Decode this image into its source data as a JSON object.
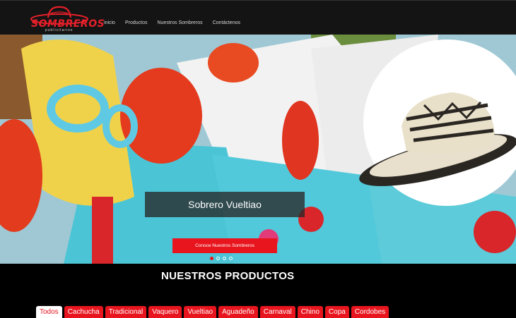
{
  "brand": {
    "logo_text": "SOMBREROS",
    "logo_subtext": "publicitarios"
  },
  "nav": {
    "items": [
      "inicio",
      "Productos",
      "Nuestros Sombreros",
      "Contáctenos"
    ]
  },
  "hero": {
    "slide_title": "Sobrero Vueltiao",
    "cta_label": "Conoce Nuestros Sombreros",
    "slides_count": 4,
    "active_slide": 1
  },
  "products": {
    "heading": "NUESTROS PRODUCTOS",
    "filters": [
      "Todos",
      "Cachucha",
      "Tradicional",
      "Vaquero",
      "Vueltiao",
      "Aguadeño",
      "Carnaval",
      "Chino",
      "Copa",
      "Cordobes"
    ],
    "active_filter": "Todos"
  },
  "colors": {
    "accent": "#e8151e",
    "topbar": "#141414",
    "background": "#000000"
  }
}
